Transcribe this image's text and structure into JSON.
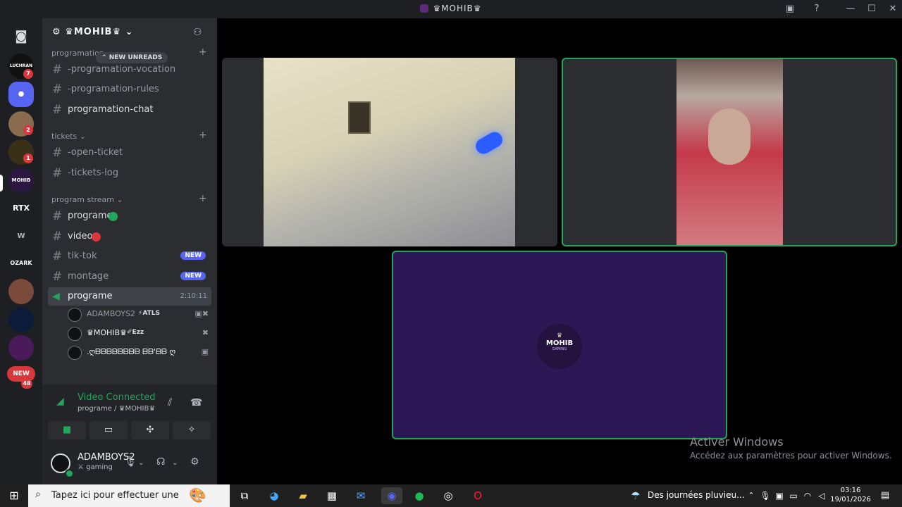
{
  "window": {
    "title": "♛MOHIB♛",
    "min": "—",
    "max": "☐",
    "close": "✕"
  },
  "guilds": {
    "items": [
      {
        "label": "LUCHRAN",
        "badge": "7"
      },
      {
        "label": "",
        "badge": ""
      },
      {
        "label": "",
        "badge": "2"
      },
      {
        "label": "",
        "badge": "1"
      },
      {
        "label": "MOHIB",
        "badge": ""
      },
      {
        "label": "RTX",
        "badge": ""
      },
      {
        "label": "W",
        "badge": ""
      },
      {
        "label": "OZARK",
        "badge": ""
      },
      {
        "label": "",
        "badge": ""
      },
      {
        "label": "",
        "badge": ""
      },
      {
        "label": "",
        "badge": ""
      }
    ],
    "new_label": "NEW",
    "new_count": "48"
  },
  "server": {
    "name": "♛MOHIB♛"
  },
  "sidebar": {
    "new_unreads": "NEW UNREADS",
    "categories": [
      {
        "name": "programation",
        "channels": [
          "-programation-vocation",
          "-programation-rules",
          "programation-chat"
        ]
      },
      {
        "name": "tickets",
        "channels": [
          "-open-ticket",
          "-tickets-log"
        ]
      },
      {
        "name": "program stream",
        "channels": [
          "programe",
          "video",
          "tik-tok",
          "montage"
        ]
      }
    ],
    "new_badge": "NEW",
    "voice_channel": {
      "name": "programe",
      "timer": "2:10:11"
    },
    "members": [
      "ADAMBOYS2",
      "♛MOHIB♛",
      ".ღᗷᗷᗷᗷᗷᗷᗷᗷ ᗷᗷ'ᗷᗷ ღ"
    ],
    "member_tags": [
      "ATLS",
      "Ezz",
      ""
    ]
  },
  "voice": {
    "status": "Video Connected",
    "location": "programe / ♛MOHIB♛"
  },
  "user": {
    "name": "ADAMBOYS2",
    "status": "gaming"
  },
  "stage": {
    "tile_logo": "MOHIB",
    "tile_logo_sub": "GAMING"
  },
  "watermark": {
    "line1": "Activer Windows",
    "line2": "Accédez aux paramètres pour activer Windows."
  },
  "taskbar": {
    "search_placeholder": "Tapez ici pour effectuer une",
    "weather": "Des journées pluvieu...",
    "time": "03:16",
    "date": "19/01/2026"
  }
}
